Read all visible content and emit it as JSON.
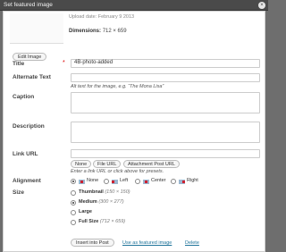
{
  "dialog": {
    "title": "Set featured image",
    "close_label": "×"
  },
  "attachment": {
    "meta_line": "Upload date: February 9 2013",
    "dims_label": "Dimensions:",
    "dims_value": "712 × 659",
    "edit_label": "Edit Image"
  },
  "fields": {
    "title_label": "Title",
    "title_required": "*",
    "title_value": "4B-photo-added",
    "alt_label": "Alternate Text",
    "alt_help": "Alt text for the image, e.g. “The Mona Lisa”",
    "caption_label": "Caption",
    "description_label": "Description",
    "link_label": "Link URL",
    "link_buttons": [
      "None",
      "File URL",
      "Attachment Post URL"
    ],
    "link_help": "Enter a link URL or click above for presets."
  },
  "alignment": {
    "label": "Alignment",
    "options": [
      "None",
      "Left",
      "Center",
      "Right"
    ],
    "selected": "None"
  },
  "size": {
    "label": "Size",
    "options": [
      {
        "name": "Thumbnail",
        "dims": "(150 × 150)"
      },
      {
        "name": "Medium",
        "dims": "(300 × 277)"
      },
      {
        "name": "Large",
        "dims": ""
      },
      {
        "name": "Full Size",
        "dims": "(712 × 659)"
      }
    ],
    "selected": "Medium"
  },
  "actions": {
    "insert_label": "Insert into Post",
    "featured_label": "Use as featured image",
    "delete_label": "Delete"
  }
}
